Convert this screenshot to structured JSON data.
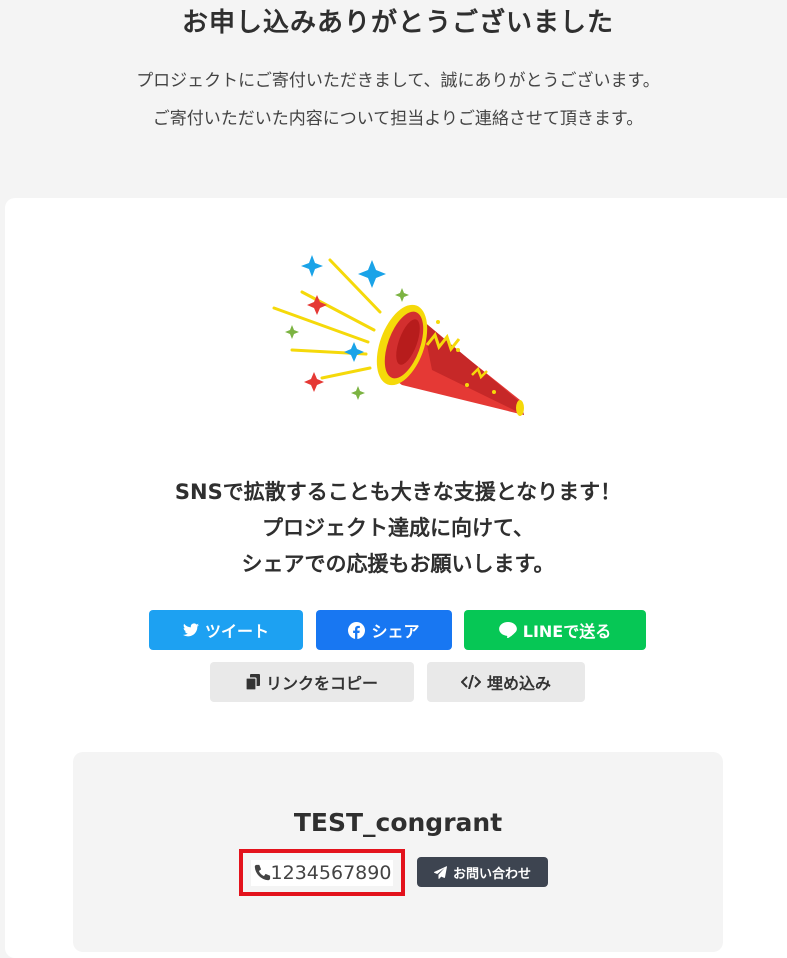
{
  "header": {
    "title": "お申し込みありがとうございました",
    "message_line1": "プロジェクトにご寄付いただきまして、誠にありがとうございます。",
    "message_line2": "ご寄付いただいた内容について担当よりご連絡させて頂きます。"
  },
  "share": {
    "line1": "SNSで拡散することも大きな支援となります！",
    "line2": "プロジェクト達成に向けて、",
    "line3": "シェアでの応援もお願いします。",
    "buttons": {
      "twitter": "ツイート",
      "facebook": "シェア",
      "line": "LINEで送る",
      "copy_link": "リンクをコピー",
      "embed": "埋め込み"
    },
    "icons": {
      "twitter": "twitter-bird-icon",
      "facebook": "facebook-icon",
      "line": "line-chat-bubble-icon",
      "copy_link": "copy-icon",
      "embed": "code-icon"
    }
  },
  "organization": {
    "name": "TEST_congrant",
    "phone": "1234567890",
    "contact_label": "お問い合わせ",
    "phone_icon": "phone-icon",
    "contact_icon": "paper-plane-icon"
  },
  "colors": {
    "twitter": "#1da1f2",
    "facebook": "#1877f2",
    "line": "#06c755",
    "highlight_border": "#e3121c",
    "contact_button": "#3d4450"
  }
}
